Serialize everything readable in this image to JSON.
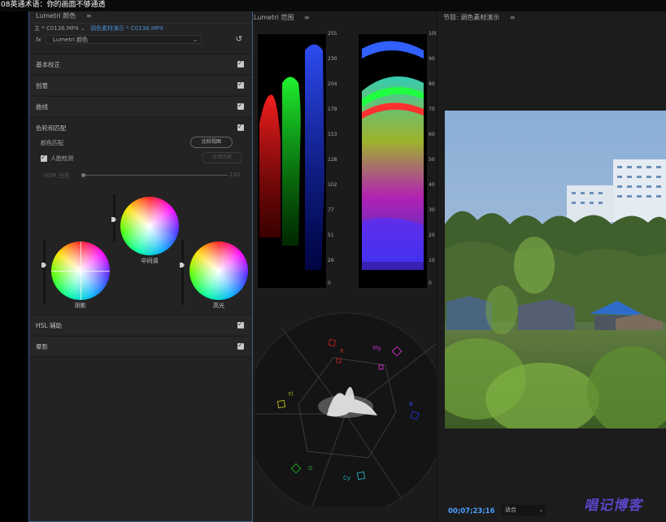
{
  "caption": "08英通术语：你的画面不够通透",
  "lumetri": {
    "tab_title": "Lumetri 颜色",
    "menu_glyph": "≡",
    "clip_master": "主 * C0136.MP4",
    "clip_arrow": "⌄",
    "clip_sequence": "调色素材演示 * C0136.MP4",
    "fx_symbol": "fx",
    "effect_name": "Lumetri 颜色",
    "reset_glyph": "↺",
    "sections": {
      "basic": "基本校正",
      "creative": "创意",
      "curves": "曲线",
      "wheels": "色轮和匹配",
      "hsl": "HSL 辅助",
      "vignette": "晕影"
    },
    "color_match_label": "颜色匹配",
    "compare_view_button": "比较视图",
    "face_detect_label": "人脸检测",
    "apply_match_button": "应用匹配",
    "hdr_label": "HDR 白色",
    "hdr_value": "100",
    "wheel_labels": {
      "shadows": "阴影",
      "midtones": "中间调",
      "highlights": "高光"
    }
  },
  "scopes": {
    "tab_title": "Lumetri 范围",
    "menu_glyph": "≡",
    "left_axis": [
      "255",
      "230",
      "204",
      "179",
      "153",
      "128",
      "102",
      "77",
      "51",
      "26",
      "0"
    ],
    "right_axis": [
      "100",
      "90",
      "80",
      "70",
      "60",
      "50",
      "40",
      "30",
      "20",
      "10",
      "0"
    ],
    "vector_labels": {
      "r": "R",
      "mg": "Mg",
      "b": "B",
      "cy": "Cy",
      "g": "G",
      "yl": "Yl"
    }
  },
  "program": {
    "tab_title": "节目: 调色素材演示",
    "menu_glyph": "≡",
    "timecode": "00;07;23;16",
    "fit": "适合",
    "fit_arrow": "⌄",
    "watermark": "唱记博客"
  },
  "colors": {
    "accent_blue": "#4a8fd6",
    "timecode_blue": "#4a9fff",
    "panel_bg": "#232323"
  }
}
